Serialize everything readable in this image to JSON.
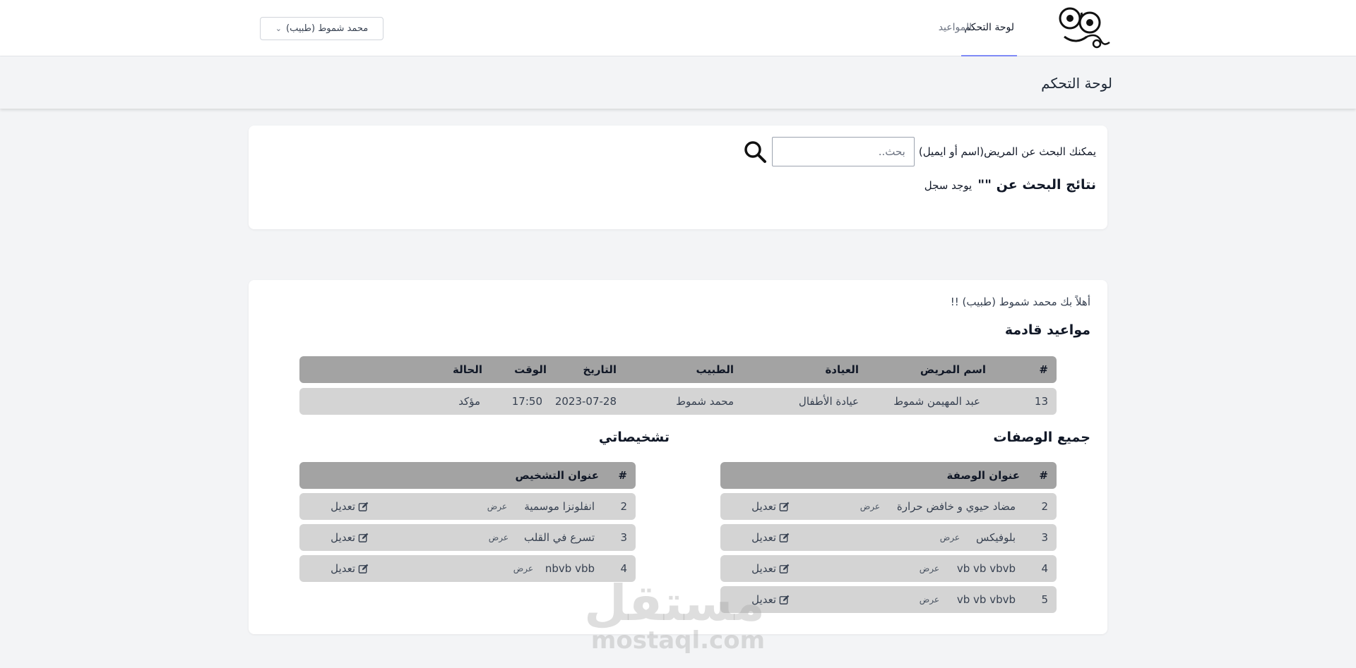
{
  "nav": {
    "dashboard": "لوحة التحكم",
    "appointments": "المواعيد",
    "user_menu": "محمد شموط (طبيب)"
  },
  "header": {
    "title": "لوحة التحكم"
  },
  "search": {
    "label": "يمكنك البحث عن المريض(اسم أو ايميل)",
    "placeholder": "بحث..",
    "results_title": "نتائج البحث عن \"\"",
    "results_count": "يوجد سجل"
  },
  "welcome": "أهلاً بك محمد شموط (طبيب) !!",
  "upcoming": {
    "title": "مواعيد قادمة",
    "columns": {
      "num": "#",
      "patient": "اسم المريض",
      "clinic": "العيادة",
      "doctor": "الطبيب",
      "date": "التاريخ",
      "time": "الوقت",
      "status": "الحالة"
    },
    "rows": [
      {
        "num": "13",
        "patient": "عبد المهيمن شموط",
        "clinic": "عيادة الأطفال",
        "doctor": "محمد شموط",
        "date": "2023-07-28",
        "time": "17:50",
        "status": "مؤكد"
      }
    ]
  },
  "prescriptions": {
    "title": "جميع الوصفات",
    "columns": {
      "num": "#",
      "title": "عنوان الوصفة"
    },
    "view_label": "عرض",
    "edit_label": "تعديل",
    "rows": [
      {
        "num": "2",
        "title": "مضاد حيوي و خافض حرارة"
      },
      {
        "num": "3",
        "title": "بلوفيكس"
      },
      {
        "num": "4",
        "title": "vb vb vbvb"
      },
      {
        "num": "5",
        "title": "vb vb vbvb"
      }
    ]
  },
  "diagnoses": {
    "title": "تشخيصاتي",
    "columns": {
      "num": "#",
      "title": "عنوان التشخيص"
    },
    "view_label": "عرض",
    "edit_label": "تعديل",
    "rows": [
      {
        "num": "2",
        "title": "انفلونزا موسمية"
      },
      {
        "num": "3",
        "title": "تسرع في القلب"
      },
      {
        "num": "4",
        "title": "nbvb vbb"
      }
    ]
  },
  "watermark": {
    "arabic": "مستقل",
    "latin": "mostaql.com"
  },
  "icons": {
    "logo": "cartoon-face-logo",
    "search": "magnifier-icon",
    "edit": "pencil-square-icon",
    "dropdown": "chevron-down-icon"
  },
  "colors": {
    "nav_active_underline": "#818cf8",
    "table_header": "#a3a3a3",
    "table_row": "#d4d4d4"
  }
}
